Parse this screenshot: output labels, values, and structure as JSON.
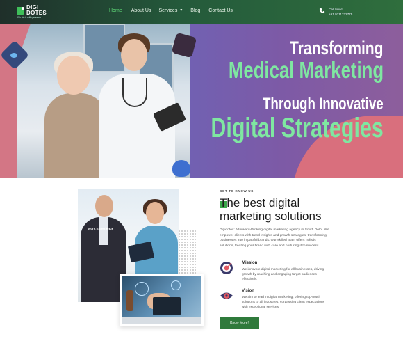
{
  "brand": {
    "name_line1": "DIGI",
    "name_line2": "DOTES",
    "tagline": "We do it with passion"
  },
  "nav": {
    "items": [
      {
        "label": "Home",
        "active": true
      },
      {
        "label": "About Us",
        "active": false
      },
      {
        "label": "Services",
        "active": false,
        "has_caret": true
      },
      {
        "label": "Blog",
        "active": false
      },
      {
        "label": "Contact Us",
        "active": false
      }
    ]
  },
  "contact": {
    "label": "Call Now!!",
    "phone": "+91 9311222775",
    "icon": "phone-icon"
  },
  "hero": {
    "line1": "Transforming",
    "line2": "Medical Marketing",
    "line3": "Through Innovative",
    "line4": "Digital Strategies",
    "colors": {
      "white": "#ffffff",
      "accent": "#7fe7a1"
    }
  },
  "about": {
    "eyebrow": "GET TO KNOW US",
    "title_line1": "The best digital",
    "title_line2": "marketing solutions",
    "description": "Digidotes: A forward-thinking digital marketing agency in South Delhi. We empower clients with trend insights and growth strategies, transforming businesses into impactful brands. Our skilled team offers holistic solutions, treating your brand with care and nurturing it to success.",
    "experience_label": "Work Experience",
    "features": [
      {
        "icon": "target-icon",
        "title": "Mission",
        "text": "We innovate digital marketing for all businesses, driving growth by reaching and engaging target audiences effectively."
      },
      {
        "icon": "eye-icon",
        "title": "Vision",
        "text": "We aim to lead in digital marketing, offering top-notch solutions to all industries, surpassing client expectations with exceptional services."
      }
    ],
    "cta_label": "Know More!"
  },
  "colors": {
    "brand_green": "#2f7a3b",
    "nav_active": "#62e07b"
  }
}
